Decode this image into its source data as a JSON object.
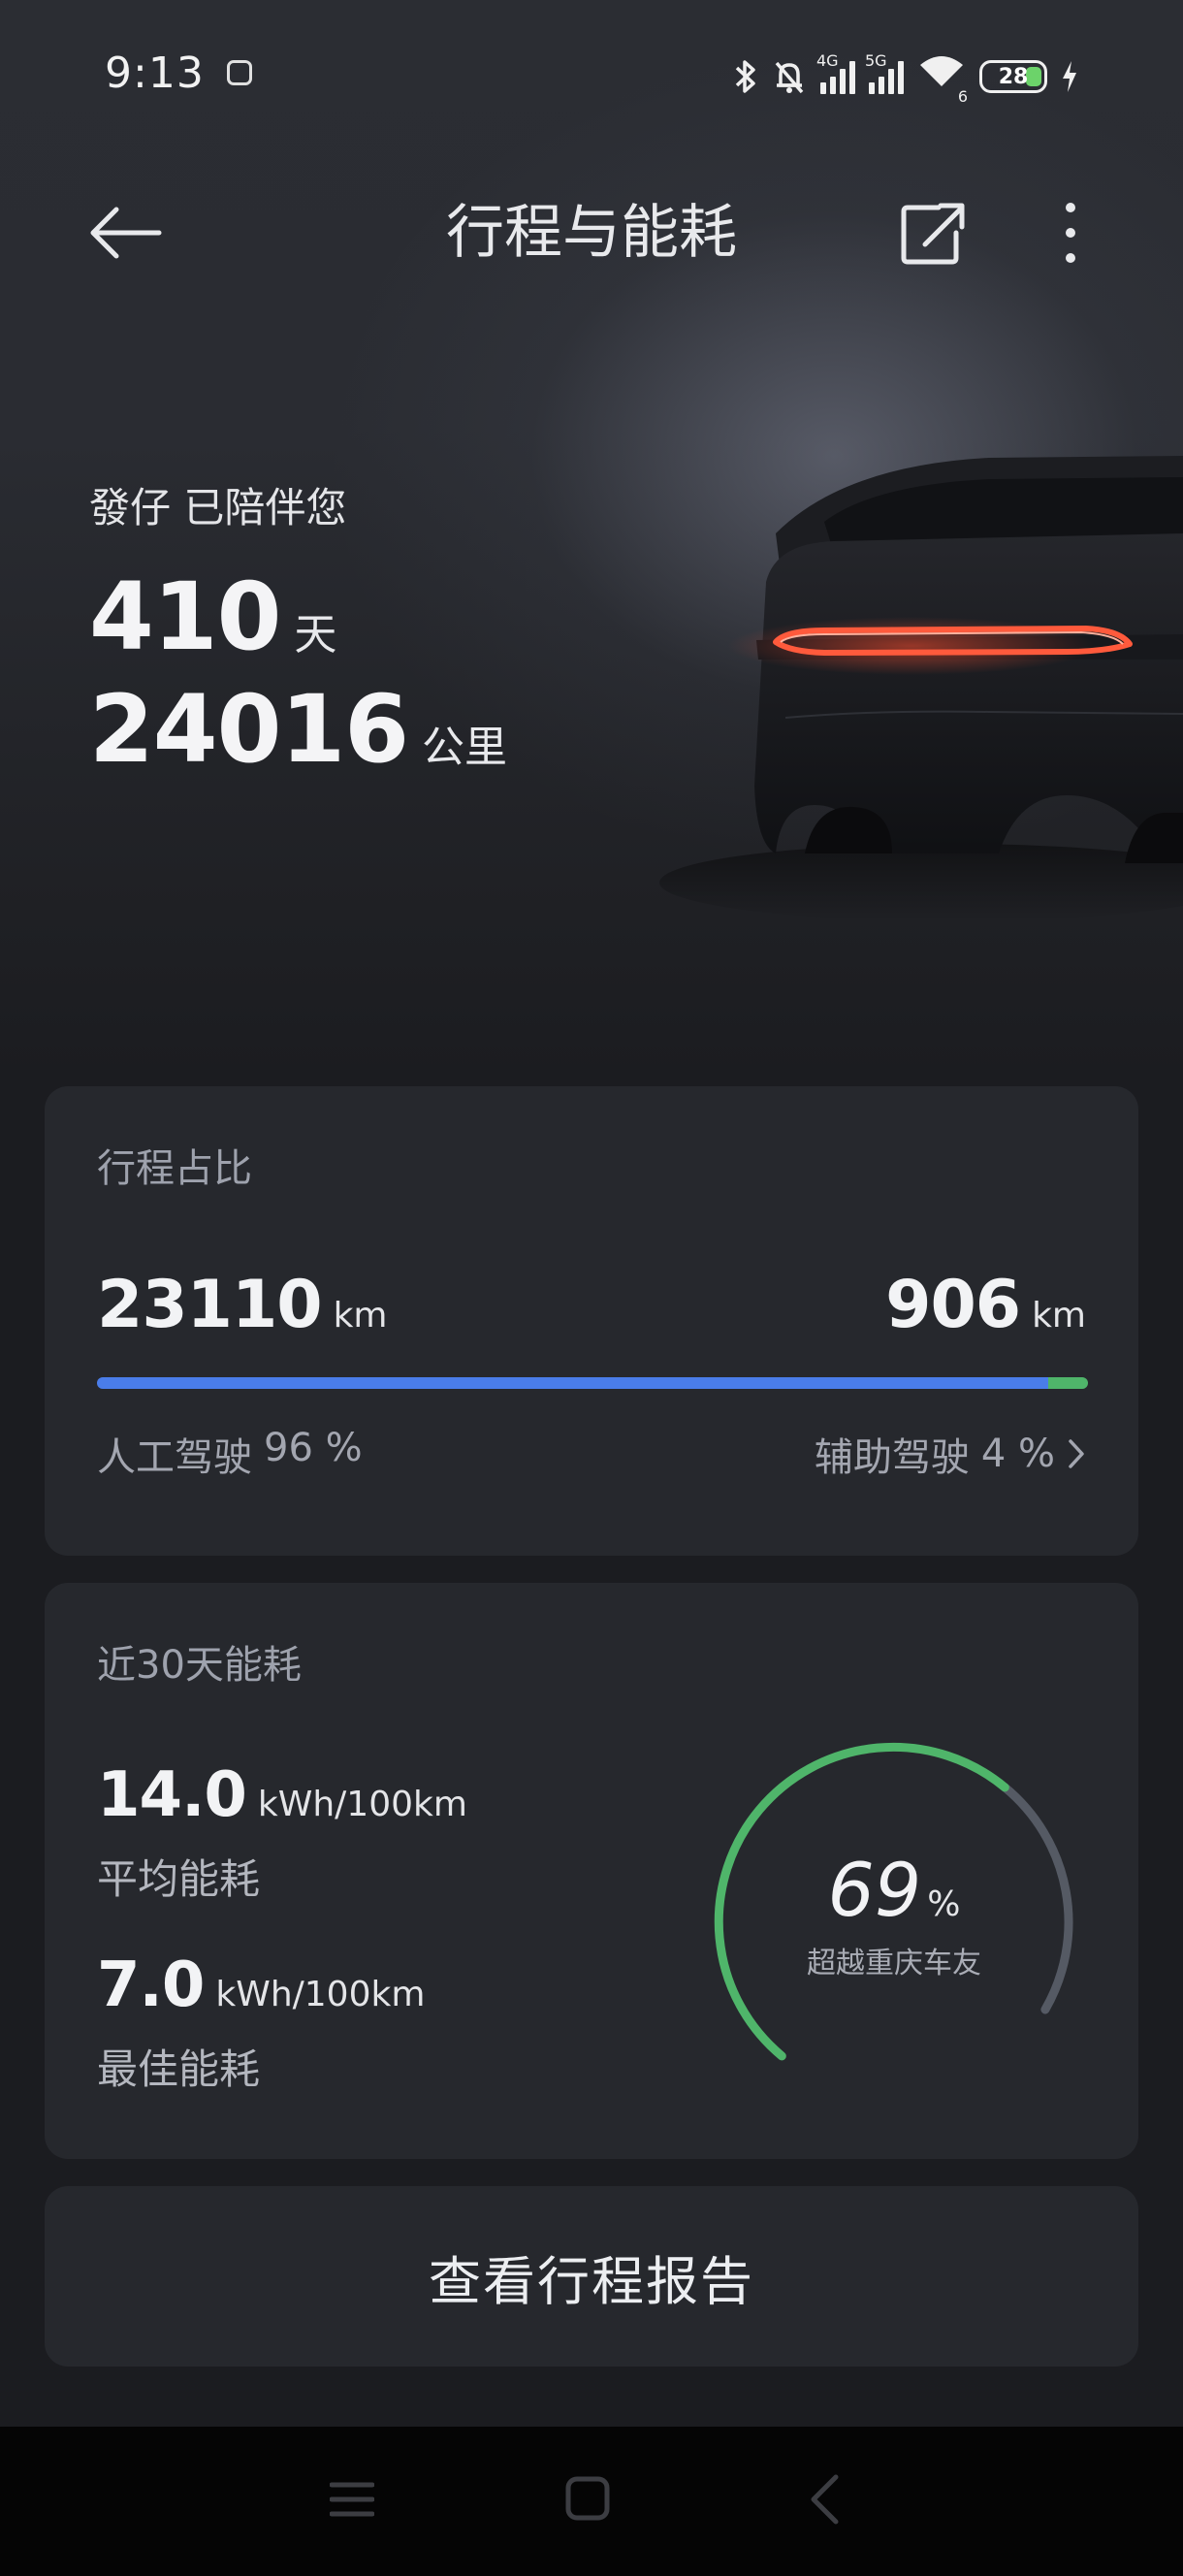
{
  "status_bar": {
    "time": "9:13",
    "net1": "4G",
    "net2": "5G",
    "wifi_sub": "6",
    "battery": "28"
  },
  "header": {
    "title": "行程与能耗"
  },
  "hero": {
    "companion_text": "發仔 已陪伴您",
    "days": "410",
    "days_unit": "天",
    "distance": "24016",
    "distance_unit": "公里"
  },
  "trip_card": {
    "title": "行程占比",
    "manual_km": "23110",
    "assist_km": "906",
    "unit": "km",
    "manual_label": "人工驾驶",
    "manual_percent_text": "96 %",
    "assist_label": "辅助驾驶",
    "assist_percent_text": "4 %",
    "manual_fraction": 0.96,
    "assist_fraction": 0.04,
    "colors": {
      "manual": "#4a7de9",
      "assist": "#4fb56a"
    }
  },
  "energy_card": {
    "title": "近30天能耗",
    "avg_value": "14.0",
    "avg_unit": "kWh/100km",
    "avg_label": "平均能耗",
    "best_value": "7.0",
    "best_unit": "kWh/100km",
    "best_label": "最佳能耗",
    "gauge_percent": "69",
    "gauge_percent_unit": "%",
    "gauge_fraction": 0.69,
    "gauge_subtitle": "超越重庆车友",
    "colors": {
      "gauge_fill": "#4fb56a",
      "gauge_track": "#555a64"
    }
  },
  "report_button": {
    "label": "查看行程报告"
  },
  "icons": [
    "bluetooth-icon",
    "mute-icon",
    "signal-icon",
    "wifi-icon",
    "battery-icon",
    "charging-icon",
    "back-arrow-icon",
    "share-icon",
    "more-icon",
    "menu-icon",
    "home-icon",
    "nav-back-icon"
  ]
}
